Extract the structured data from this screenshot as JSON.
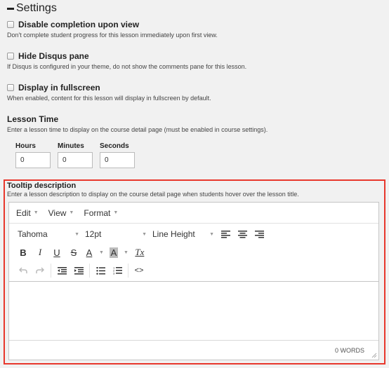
{
  "section": {
    "title": "Settings",
    "icon": "minus-icon"
  },
  "settings": [
    {
      "label": "Disable completion upon view",
      "description": "Don't complete student progress for this lesson immediately upon first view."
    },
    {
      "label": "Hide Disqus pane",
      "description": "If Disqus is configured in your theme, do not show the comments pane for this lesson."
    },
    {
      "label": "Display in fullscreen",
      "description": "When enabled, content for this lesson will display in fullscreen by default."
    }
  ],
  "lesson_time": {
    "title": "Lesson Time",
    "description": "Enter a lesson time to display on the course detail page (must be enabled in course settings).",
    "fields": [
      {
        "label": "Hours",
        "value": "0"
      },
      {
        "label": "Minutes",
        "value": "0"
      },
      {
        "label": "Seconds",
        "value": "0"
      }
    ]
  },
  "tooltip": {
    "title": "Tooltip description",
    "description": "Enter a lesson description to display on the course detail page when students hover over the lesson title.",
    "highlight_color": "#e8372c"
  },
  "editor": {
    "menus": [
      "Edit",
      "View",
      "Format"
    ],
    "font_family": "Tahoma",
    "font_size": "12pt",
    "line_height": "Line Height",
    "word_count": "0 WORDS",
    "buttons": {
      "bold": "B",
      "italic": "I",
      "underline": "U",
      "strikethrough": "S",
      "text_color": "A",
      "background_color": "A",
      "clear_format": "Tx",
      "code": "<>"
    }
  }
}
